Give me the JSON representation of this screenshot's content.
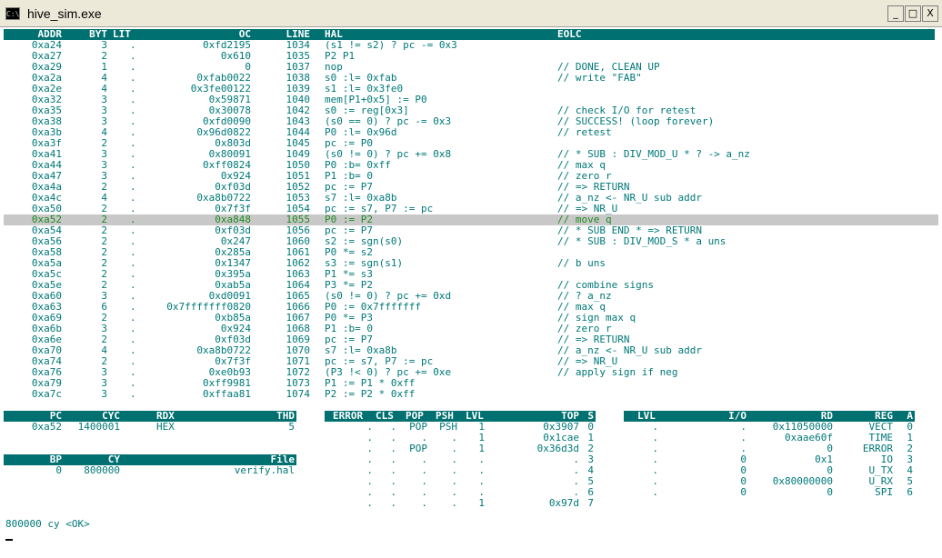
{
  "window": {
    "title": "hive_sim.exe",
    "icon_text": "C:\\",
    "min": "_",
    "max": "□",
    "close": "X"
  },
  "code": {
    "headers": {
      "addr": "ADDR",
      "byt": "BYT",
      "lit": "LIT",
      "oc": "OC",
      "line": "LINE",
      "hal": "HAL",
      "eolc": "EOLC"
    },
    "selected_index": 16,
    "rows": [
      [
        "0xa24",
        "3",
        ".",
        "0xfd2195",
        "1034",
        "(s1 != s2) ? pc -= 0x3",
        ""
      ],
      [
        "0xa27",
        "2",
        ".",
        "0x610",
        "1035",
        "P2 P1",
        ""
      ],
      [
        "0xa29",
        "1",
        ".",
        "0",
        "1037",
        "nop",
        "// DONE, CLEAN UP"
      ],
      [
        "0xa2a",
        "4",
        ".",
        "0xfab0022",
        "1038",
        "s0 :l= 0xfab",
        "// write \"FAB\""
      ],
      [
        "0xa2e",
        "4",
        ".",
        "0x3fe00122",
        "1039",
        "s1 :l= 0x3fe0",
        ""
      ],
      [
        "0xa32",
        "3",
        ".",
        "0x59871",
        "1040",
        "mem[P1+0x5] := P0",
        ""
      ],
      [
        "0xa35",
        "3",
        ".",
        "0x30078",
        "1042",
        "s0 := reg[0x3]",
        "// check I/O for retest"
      ],
      [
        "0xa38",
        "3",
        ".",
        "0xfd0090",
        "1043",
        "(s0 == 0) ? pc -= 0x3",
        "// SUCCESS! (loop forever)"
      ],
      [
        "0xa3b",
        "4",
        ".",
        "0x96d0822",
        "1044",
        "P0 :l= 0x96d",
        "// retest"
      ],
      [
        "0xa3f",
        "2",
        ".",
        "0x803d",
        "1045",
        "pc := P0",
        ""
      ],
      [
        "0xa41",
        "3",
        ".",
        "0x80091",
        "1049",
        "(s0 != 0) ? pc += 0x8",
        "// * SUB : DIV_MOD_U * ? -> a_nz"
      ],
      [
        "0xa44",
        "3",
        ".",
        "0xff0824",
        "1050",
        "P0 :b= 0xff",
        "// max q"
      ],
      [
        "0xa47",
        "3",
        ".",
        "0x924",
        "1051",
        "P1 :b= 0",
        "// zero r"
      ],
      [
        "0xa4a",
        "2",
        ".",
        "0xf03d",
        "1052",
        "pc := P7",
        "// => RETURN"
      ],
      [
        "0xa4c",
        "4",
        ".",
        "0xa8b0722",
        "1053",
        "s7 :l= 0xa8b",
        "// a_nz <- NR_U sub addr"
      ],
      [
        "0xa50",
        "2",
        ".",
        "0x7f3f",
        "1054",
        "pc := s7, P7 := pc",
        "// => NR_U"
      ],
      [
        "0xa52",
        "2",
        ".",
        "0xa848",
        "1055",
        "P0 := P2",
        "// move q"
      ],
      [
        "0xa54",
        "2",
        ".",
        "0xf03d",
        "1056",
        "pc := P7",
        "// * SUB END * => RETURN"
      ],
      [
        "0xa56",
        "2",
        ".",
        "0x247",
        "1060",
        "s2 := sgn(s0)",
        "// * SUB : DIV_MOD_S * a uns"
      ],
      [
        "0xa58",
        "2",
        ".",
        "0x285a",
        "1061",
        "P0 *= s2",
        ""
      ],
      [
        "0xa5a",
        "2",
        ".",
        "0x1347",
        "1062",
        "s3 := sgn(s1)",
        "// b uns"
      ],
      [
        "0xa5c",
        "2",
        ".",
        "0x395a",
        "1063",
        "P1 *= s3",
        ""
      ],
      [
        "0xa5e",
        "2",
        ".",
        "0xab5a",
        "1064",
        "P3 *= P2",
        "// combine signs"
      ],
      [
        "0xa60",
        "3",
        ".",
        "0xd0091",
        "1065",
        "(s0 != 0) ? pc += 0xd",
        "// ? a_nz"
      ],
      [
        "0xa63",
        "6",
        ".",
        "0x7fffffff0820",
        "1066",
        "P0 := 0x7fffffff",
        "// max q"
      ],
      [
        "0xa69",
        "2",
        ".",
        "0xb85a",
        "1067",
        "P0 *= P3",
        "// sign max q"
      ],
      [
        "0xa6b",
        "3",
        ".",
        "0x924",
        "1068",
        "P1 :b= 0",
        "// zero r"
      ],
      [
        "0xa6e",
        "2",
        ".",
        "0xf03d",
        "1069",
        "pc := P7",
        "// => RETURN"
      ],
      [
        "0xa70",
        "4",
        ".",
        "0xa8b0722",
        "1070",
        "s7 :l= 0xa8b",
        "// a_nz <- NR_U sub addr"
      ],
      [
        "0xa74",
        "2",
        ".",
        "0x7f3f",
        "1071",
        "pc := s7, P7 := pc",
        "// => NR_U"
      ],
      [
        "0xa76",
        "3",
        ".",
        "0xe0b93",
        "1072",
        "(P3 !< 0) ? pc += 0xe",
        "// apply sign if neg"
      ],
      [
        "0xa79",
        "3",
        ".",
        "0xff9981",
        "1073",
        "P1 := P1 * 0xff",
        ""
      ],
      [
        "0xa7c",
        "3",
        ".",
        "0xffaa81",
        "1074",
        "P2 := P2 * 0xff",
        ""
      ]
    ]
  },
  "pc_panel": {
    "headers": {
      "pc": "PC",
      "cyc": "CYC",
      "rdx": "RDX",
      "thd": "THD"
    },
    "values": {
      "pc": "0xa52",
      "cyc": "1400001",
      "rdx": "HEX",
      "thd": "5"
    }
  },
  "bp_panel": {
    "headers": {
      "bp": "BP",
      "cy": "CY",
      "file": "File"
    },
    "values": {
      "bp": "0",
      "cy": "800000",
      "file": "verify.hal"
    }
  },
  "stack_panel": {
    "headers": {
      "error": "ERROR",
      "cls": "CLS",
      "pop": "POP",
      "psh": "PSH",
      "lvl": "LVL",
      "top": "TOP",
      "s": "S"
    },
    "rows": [
      [
        ".",
        ".",
        "POP",
        "PSH",
        "1",
        "0x3907",
        "0"
      ],
      [
        ".",
        ".",
        ".",
        ".",
        "1",
        "0x1cae",
        "1"
      ],
      [
        ".",
        ".",
        "POP",
        ".",
        "1",
        "0x36d3d",
        "2"
      ],
      [
        ".",
        ".",
        ".",
        ".",
        ".",
        ".",
        "3"
      ],
      [
        ".",
        ".",
        ".",
        ".",
        ".",
        ".",
        "4"
      ],
      [
        ".",
        ".",
        ".",
        ".",
        ".",
        ".",
        "5"
      ],
      [
        ".",
        ".",
        ".",
        ".",
        ".",
        ".",
        "6"
      ],
      [
        ".",
        ".",
        ".",
        ".",
        "1",
        "0x97d",
        "7"
      ]
    ]
  },
  "reg_panel": {
    "headers": {
      "lvl": "LVL",
      "io": "I/O",
      "rd": "RD",
      "reg": "REG",
      "a": "A"
    },
    "rows": [
      [
        ".",
        ".",
        "0x11050000",
        "VECT",
        "0"
      ],
      [
        ".",
        ".",
        "0xaae60f",
        "TIME",
        "1"
      ],
      [
        ".",
        ".",
        "0",
        "ERROR",
        "2"
      ],
      [
        ".",
        "0",
        "0x1",
        "IO",
        "3"
      ],
      [
        ".",
        "0",
        "0",
        "U_TX",
        "4"
      ],
      [
        ".",
        "0",
        "0x80000000",
        "U_RX",
        "5"
      ],
      [
        ".",
        "0",
        "0",
        "SPI",
        "6"
      ]
    ]
  },
  "status_text": "800000 cy <OK>",
  "colors": {
    "text": "#007878",
    "header_bg": "#007070",
    "header_text": "#ffffff",
    "selected_bg": "#c8c8c8",
    "selected_text": "#208a20"
  }
}
